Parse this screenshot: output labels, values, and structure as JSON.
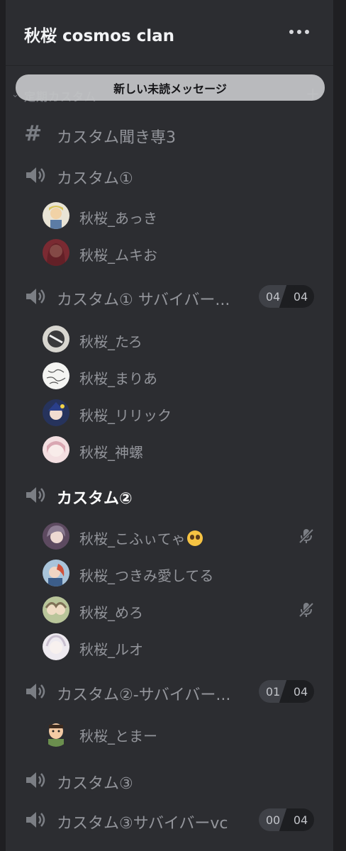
{
  "server": {
    "name": "秋桜 cosmos clan"
  },
  "category": {
    "label": "定期カスタム"
  },
  "banner": {
    "label": "新しい未読メッセージ"
  },
  "channels": [
    {
      "name": "カスタム聞き専3",
      "type": "text"
    },
    {
      "name": "カスタム①",
      "type": "voice",
      "members": [
        "秋桜_あっき",
        "秋桜_ムキお"
      ]
    },
    {
      "name": "カスタム① サバイバー...",
      "type": "voice",
      "count": "04",
      "limit": "04",
      "members": [
        "秋桜_たろ",
        "秋桜_まりあ",
        "秋桜_リリック",
        "秋桜_神螺"
      ]
    },
    {
      "name": "カスタム②",
      "type": "voice",
      "active": true,
      "members": [
        "秋桜_こふぃてゃ",
        "秋桜_つきみ愛してる",
        "秋桜_めろ",
        "秋桜_ルオ"
      ]
    },
    {
      "name": "カスタム②-サバイバー...",
      "type": "voice",
      "count": "01",
      "limit": "04",
      "members": [
        "秋桜_とまー"
      ]
    },
    {
      "name": "カスタム③",
      "type": "voice"
    },
    {
      "name": "カスタム③サバイバーvc",
      "type": "voice",
      "count": "00",
      "limit": "04"
    }
  ],
  "colors": {
    "panel": "#2c2d31",
    "background": "#1f1f22",
    "muted_text": "#93959b",
    "active_text": "#ffffff"
  },
  "icons": {
    "text_channel": "hash-icon",
    "voice_channel": "speaker-icon",
    "muted": "mic-off-icon",
    "more": "more-dots-icon",
    "add": "plus-icon",
    "collapse": "chevron-down-icon"
  }
}
